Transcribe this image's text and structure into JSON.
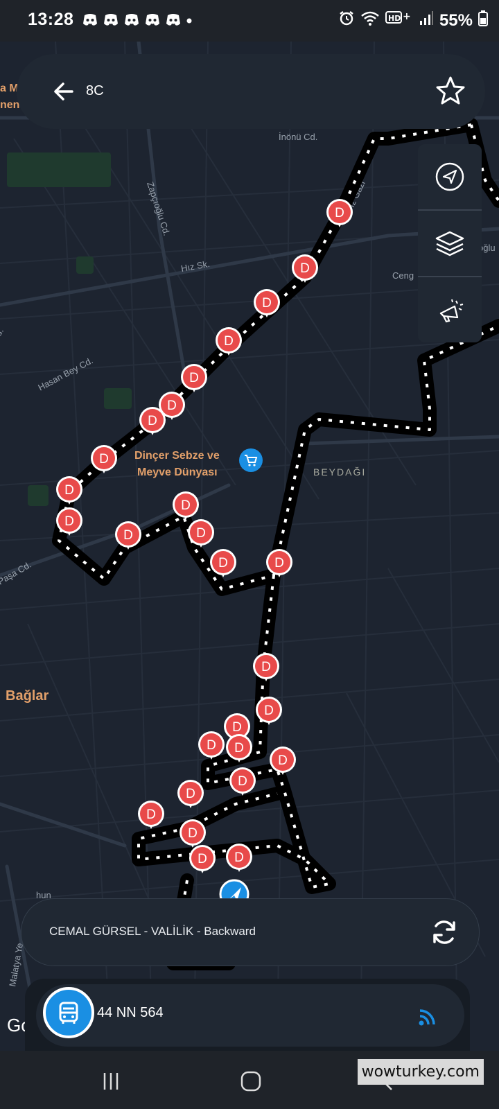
{
  "status": {
    "time": "13:28",
    "battery": "55%",
    "notification_icons": [
      "discord-icon",
      "discord-icon",
      "discord-icon",
      "discord-icon",
      "discord-icon"
    ],
    "indicators": [
      "alarm-icon",
      "wifi-icon",
      "hd-plus-icon",
      "signal-icon",
      "battery-icon"
    ]
  },
  "search": {
    "route": "8C"
  },
  "map": {
    "labels": {
      "inonu": "İnönü Cd.",
      "zapcioglu": "Zapçıoğlu Cd.",
      "hiz": "Hız Sk.",
      "hasanbey": "Hasan Bey Cd.",
      "cengiz": "Ceng",
      "oglu": "oğlu",
      "beydagi": "BEYDAĞI",
      "pasa": "Paşa Cd.",
      "baglar": "Bağlar",
      "malatya": "Malatya Ye",
      "mehmet": "met Paşa Cd.",
      "gazi": "ız Gazi",
      "hun": "hun",
      "left_top_a": "a M",
      "left_top_b": "nen",
      "left_road": "d."
    },
    "poi": {
      "name_line1": "Dinçer Sebze ve",
      "name_line2": "Meyve Dünyası"
    },
    "stop_letter": "D",
    "colors": {
      "background": "#1d2430",
      "road": "#2b3442",
      "route_outline": "#000000",
      "stop": "#e84a4a",
      "accent": "#1a8fe3",
      "label_orange": "#e3a06a"
    }
  },
  "controls": [
    "locate-icon",
    "layers-icon",
    "announce-icon"
  ],
  "route_card": {
    "name": "CEMAL GÜRSEL - VALİLİK  - Backward"
  },
  "bus": {
    "plate": "44 NN 564"
  },
  "attribution": "Go",
  "watermark": "wowturkey.com",
  "nav": [
    "recent-apps-icon",
    "home-icon",
    "back-icon"
  ]
}
